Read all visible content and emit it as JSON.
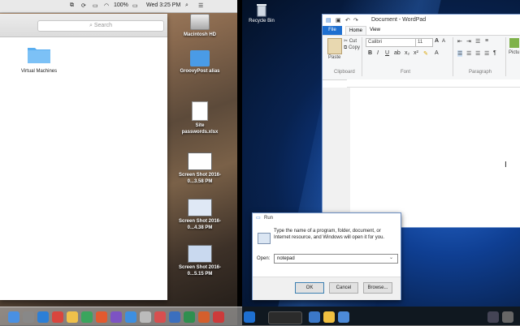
{
  "mac": {
    "menubar": {
      "battery": "100%",
      "clock": "Wed 3:25 PM"
    },
    "finder": {
      "search_placeholder": "Search",
      "items": [
        {
          "label": "Virtual Machines",
          "icon": "folder-icon"
        }
      ]
    },
    "desktop_icons": [
      {
        "label": "Macintosh HD",
        "icon": "hard-drive-icon"
      },
      {
        "label": "GroovyPost alias",
        "icon": "folder-alias-icon"
      },
      {
        "label": "Site passwords.xlsx",
        "icon": "document-icon"
      },
      {
        "label": "Screen Shot 2016-0...3.58 PM",
        "icon": "screenshot-icon"
      },
      {
        "label": "Screen Shot 2016-0...4.38 PM",
        "icon": "screenshot-icon"
      },
      {
        "label": "Screen Shot 2016-0...5.15 PM",
        "icon": "screenshot-icon"
      }
    ]
  },
  "windows": {
    "desktop": {
      "recycle_bin": "Recycle Bin"
    },
    "wordpad": {
      "title": "Document - WordPad",
      "tabs": {
        "file": "File",
        "home": "Home",
        "view": "View"
      },
      "clipboard": {
        "paste": "Paste",
        "cut": "Cut",
        "copy": "Copy",
        "group": "Clipboard"
      },
      "font": {
        "name": "Calibri",
        "size": "11",
        "group": "Font"
      },
      "paragraph": {
        "group": "Paragraph"
      },
      "picture": "Pictu"
    },
    "run": {
      "title": "Run",
      "description": "Type the name of a program, folder, document, or Internet resource, and Windows will open it for you.",
      "open_label": "Open:",
      "input_value": "notepad",
      "ok": "OK",
      "cancel": "Cancel",
      "browse": "Browse..."
    }
  },
  "colors": {
    "win_accent": "#1e6fd0",
    "folder": "#5aaef0"
  }
}
